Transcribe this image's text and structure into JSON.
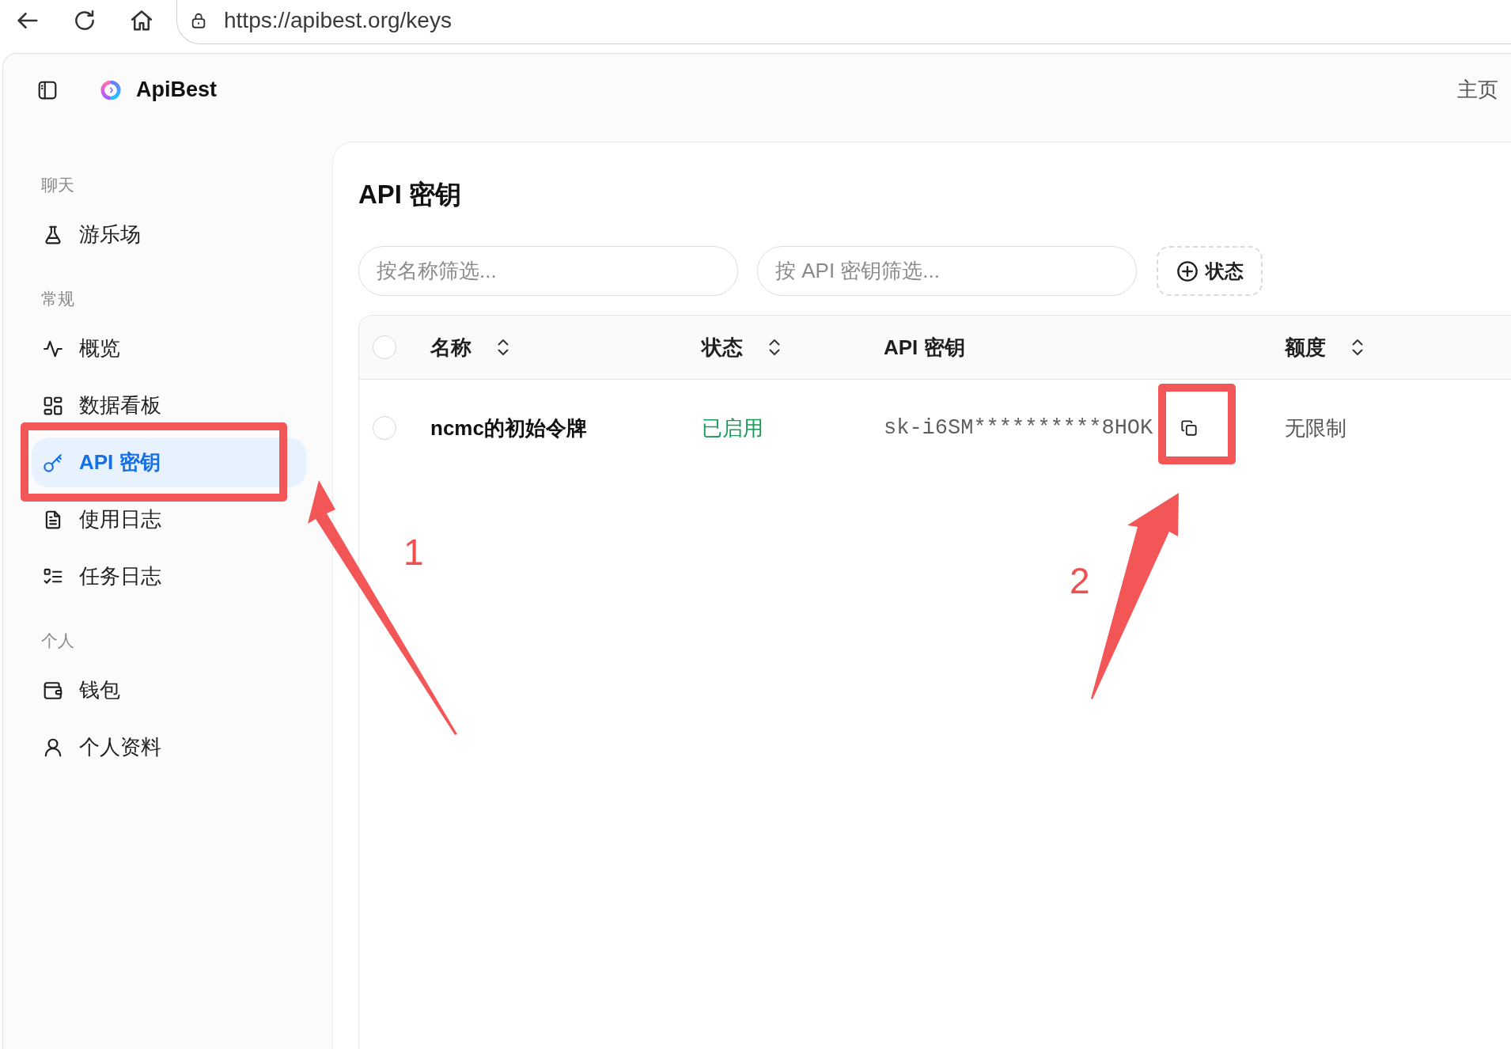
{
  "browser": {
    "url": "https://apibest.org/keys"
  },
  "header": {
    "app_name": "ApiBest",
    "home_link": "主页"
  },
  "sidebar": {
    "sections": [
      {
        "label": "聊天",
        "items": [
          {
            "label": "游乐场",
            "selected": false
          }
        ]
      },
      {
        "label": "常规",
        "items": [
          {
            "label": "概览",
            "selected": false
          },
          {
            "label": "数据看板",
            "selected": false
          },
          {
            "label": "API 密钥",
            "selected": true
          },
          {
            "label": "使用日志",
            "selected": false
          },
          {
            "label": "任务日志",
            "selected": false
          }
        ]
      },
      {
        "label": "个人",
        "items": [
          {
            "label": "钱包",
            "selected": false
          },
          {
            "label": "个人资料",
            "selected": false
          }
        ]
      }
    ]
  },
  "page": {
    "title": "API 密钥"
  },
  "filters": [
    {
      "placeholder": "按名称筛选..."
    },
    {
      "placeholder": "按 API 密钥筛选..."
    }
  ],
  "status_filter": {
    "label": "状态"
  },
  "table": {
    "select_all_checked": false,
    "columns": [
      {
        "label": "名称",
        "sortable": true
      },
      {
        "label": "状态",
        "sortable": true
      },
      {
        "label": "API 密钥",
        "sortable": false
      },
      {
        "label": "额度",
        "sortable": true
      }
    ],
    "rows": [
      {
        "selected": false,
        "name": "ncmc的初始令牌",
        "enabled": true,
        "status": "已启用",
        "key": "sk-i6SM**********8HOK",
        "quota": "无限制"
      }
    ]
  },
  "annotations": [
    {
      "label": "1"
    },
    {
      "label": "2"
    }
  ]
}
